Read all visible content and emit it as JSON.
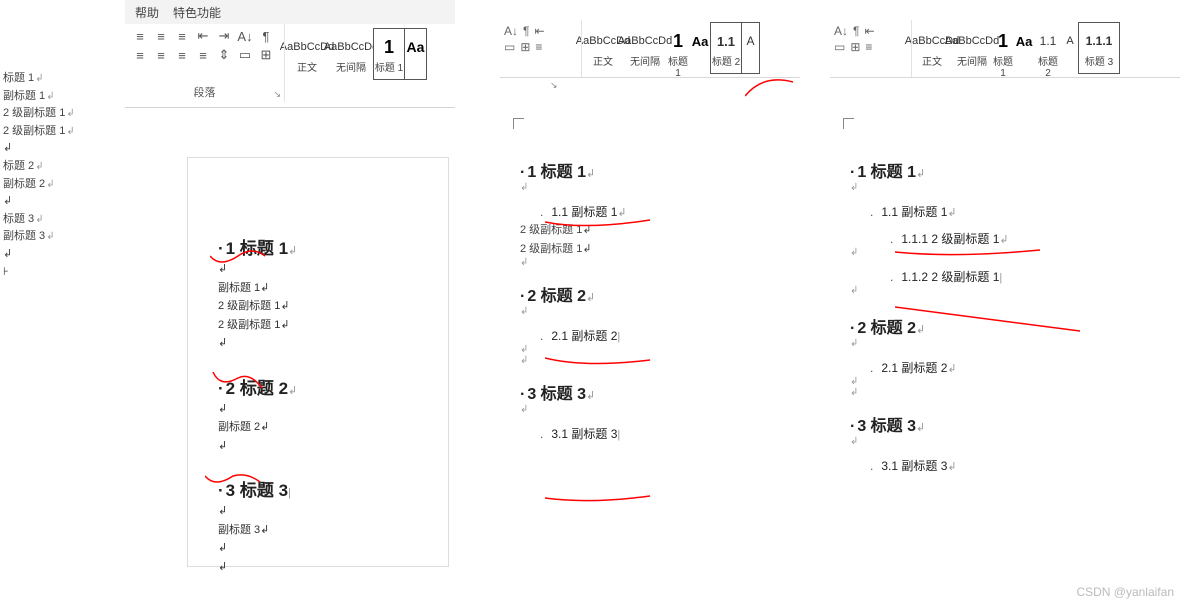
{
  "watermark": "CSDN @yanlaifan",
  "panel1": {
    "tabs": {
      "help": "帮助",
      "special": "特色功能"
    },
    "paragraph_group_label": "段落",
    "styles": {
      "normal": {
        "preview": "AaBbCcDd",
        "name": "正文"
      },
      "nospace": {
        "preview": "AaBbCcDd",
        "name": "无间隔"
      },
      "h1": {
        "preview": "1",
        "name": "标题 1"
      },
      "h1aux": {
        "preview": "Aa",
        "name": ""
      }
    },
    "selected_style": "h1",
    "nav": [
      "标题 1",
      "副标题 1",
      "2 级副标题 1",
      "2 级副标题 1",
      "",
      "标题 2",
      "副标题 2",
      "",
      "标题 3",
      "副标题 3",
      "",
      ""
    ],
    "doc": {
      "h1_1": "1 标题 1",
      "b1_1": "副标题 1↲",
      "b1_2": "2 级副标题 1↲",
      "b1_3": "2 级副标题 1↲",
      "h1_2": "2 标题 2",
      "b2_1": "副标题 2↲",
      "h1_3": "3 标题 3",
      "b3_1": "副标题 3↲"
    }
  },
  "panel2": {
    "styles": {
      "normal": {
        "preview": "AaBbCcDd",
        "name": "正文"
      },
      "nospace": {
        "preview": "AaBbCcDd",
        "name": "无间隔"
      },
      "h1": {
        "preview": "1",
        "name": "标题 1"
      },
      "h1aux": {
        "preview": "Aa",
        "name": ""
      },
      "h2": {
        "preview": "1.1",
        "name": "标题 2"
      },
      "h2aux": {
        "preview": "A",
        "name": ""
      }
    },
    "selected_style": "h2",
    "doc": {
      "h1_1": "1 标题 1",
      "h2_1": "1.1  副标题 1",
      "b1_1": "2 级副标题 1↲",
      "b1_2": "2 级副标题 1↲",
      "h1_2": "2 标题 2",
      "h2_2": "2.1  副标题 2",
      "h1_3": "3 标题 3",
      "h2_3": "3.1  副标题 3"
    }
  },
  "panel3": {
    "styles": {
      "normal": {
        "preview": "AaBbCcDd",
        "name": "正文"
      },
      "nospace": {
        "preview": "AaBbCcDd",
        "name": "无间隔"
      },
      "h1": {
        "preview": "1",
        "name": "标题 1"
      },
      "h1aux": {
        "preview": "Aa",
        "name": ""
      },
      "h2": {
        "preview": "1.1",
        "name": "标题 2"
      },
      "h2aux": {
        "preview": "A",
        "name": ""
      },
      "h3": {
        "preview": "1.1.1",
        "name": "标题 3"
      }
    },
    "selected_style": "h3",
    "doc": {
      "h1_1": "1 标题 1",
      "h2_1": "1.1  副标题 1",
      "h3_1": "1.1.1 2 级副标题 1",
      "h3_2": "1.1.2 2 级副标题 1",
      "h1_2": "2 标题 2",
      "h2_2": "2.1  副标题 2",
      "h1_3": "3 标题 3",
      "h2_3": "3.1  副标题 3"
    }
  }
}
